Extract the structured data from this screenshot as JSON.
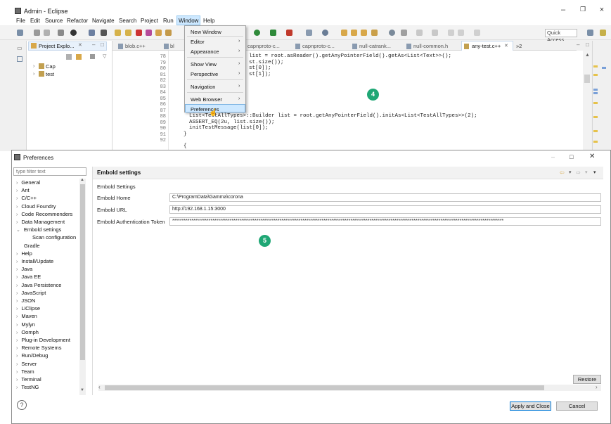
{
  "eclipse": {
    "title": "Admin - Eclipse",
    "window_controls": [
      "–",
      "❐",
      "×"
    ],
    "menu": [
      "File",
      "Edit",
      "Source",
      "Refactor",
      "Navigate",
      "Search",
      "Project",
      "Run",
      "Window",
      "Help"
    ],
    "quick_access": "Quick Access",
    "project_explorer": {
      "tab": "Project Explo...",
      "items": [
        {
          "label": "Cap"
        },
        {
          "label": "test"
        }
      ]
    },
    "editor_tabs": [
      "blob.c++",
      "bl",
      "capnproto-c...",
      "capnproto-c...",
      "null-catrank...",
      "null-common.h",
      "any-test.c++",
      "»2"
    ],
    "line_numbers": [
      "78",
      "79",
      "80",
      "81",
      "82",
      "83",
      "84",
      "85",
      "86",
      "87",
      "88",
      "89",
      "90",
      "91",
      "92"
    ],
    "code_lines": [
      "list = root.asReader().getAnyPointerField().getAs<List<Text>>();",
      "st.size());",
      "st[0]);",
      "st[1]);",
      "List<TestAllTypes>::Builder list = root.getAnyPointerField().initAs<List<TestAllTypes>>(2);",
      "ASSERT_EQ(2u, list.size());",
      "initTestMessage(list[0]);",
      "}",
      "{"
    ],
    "window_menu": {
      "items": [
        "New Window",
        "Editor",
        "Appearance",
        "Show View",
        "Perspective",
        "Navigation",
        "Web Browser",
        "Preferences"
      ]
    }
  },
  "badges": {
    "four": "4",
    "five": "5"
  },
  "preferences": {
    "title": "Preferences",
    "filter_placeholder": "type filter text",
    "nav_items": [
      "General",
      "Ant",
      "C/C++",
      "Cloud Foundry",
      "Code Recommenders",
      "Data Management",
      "Embold settings",
      "Scan configuration",
      "Gradle",
      "Help",
      "Install/Update",
      "Java",
      "Java EE",
      "Java Persistence",
      "JavaScript",
      "JSON",
      "LiClipse",
      "Maven",
      "Mylyn",
      "Oomph",
      "Plug-in Development",
      "Remote Systems",
      "Run/Debug",
      "Server",
      "Team",
      "Terminal",
      "TestNG"
    ],
    "page_title": "Embold settings",
    "section": "Embold Settings",
    "fields": {
      "home_label": "Embold Home",
      "home_value": "C:\\ProgramData\\Gamma\\corona",
      "url_label": "Embold URL",
      "url_value": "http://192.168.1.15:3000",
      "token_label": "Embold Authentication Token",
      "token_value": "*****************************************************************************************************************************************************************************"
    },
    "restore_defaults": "Restore Def",
    "apply_close": "Apply and Close",
    "cancel": "Cancel",
    "help_symbol": "?"
  },
  "colors": {
    "accent": "#1fa775",
    "menu_highlight": "#cde8ff"
  }
}
